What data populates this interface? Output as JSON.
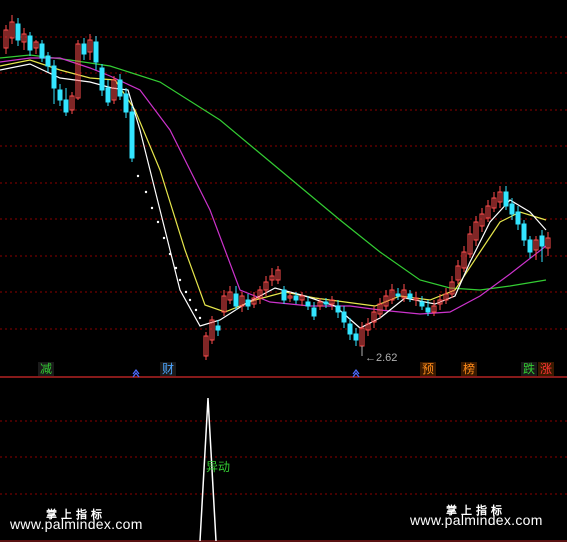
{
  "colors": {
    "background": "#000000",
    "grid": "#8b0000",
    "divider": "#b22222",
    "candle_up": "#ff4d4d",
    "candle_down": "#33e5ff",
    "ma_white": "#ffffff",
    "ma_yellow": "#e6e64c",
    "ma_magenta": "#cc33cc",
    "ma_green": "#33cc33",
    "spike": "#ffffff"
  },
  "signals": [
    {
      "label": "减",
      "color": "#33cc33",
      "bg": "#1a1a1a"
    },
    {
      "label": "财",
      "color": "#4da6ff",
      "bg": "#1a1a1a"
    },
    {
      "label": "预",
      "color": "#ff8c1a",
      "bg": "#3a1a00"
    },
    {
      "label": "榜",
      "color": "#ff8c1a",
      "bg": "#3a1a00"
    },
    {
      "label": "跌",
      "color": "#33cc33",
      "bg": "#1a1a1a"
    },
    {
      "label": "涨",
      "color": "#ff3333",
      "bg": "#3a1a00"
    }
  ],
  "low_marker": {
    "label": "←2.62"
  },
  "indicator": {
    "label": "异动"
  },
  "watermarks": [
    {
      "cn": "掌上指标",
      "url": "www.palmindex.com"
    },
    {
      "cn": "掌上指标",
      "url": "www.palmindex.com"
    }
  ]
}
